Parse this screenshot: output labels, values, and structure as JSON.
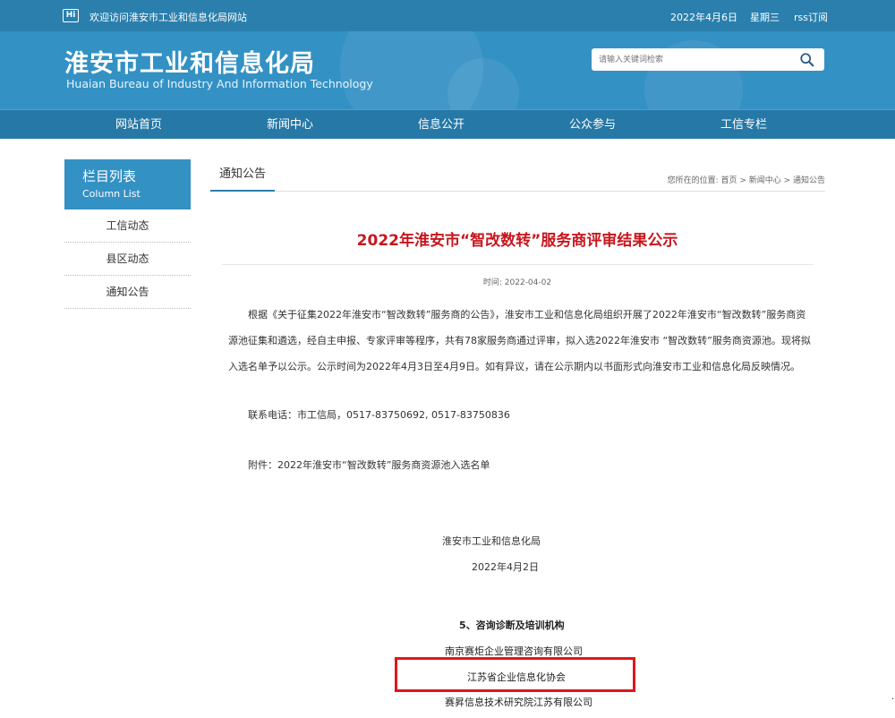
{
  "topbar": {
    "logo": "Hi",
    "welcome": "欢迎访问淮安市工业和信息化局网站",
    "date": "2022年4月6日",
    "weekday": "星期三",
    "rss": "rss订阅"
  },
  "header": {
    "title": "淮安市工业和信息化局",
    "subtitle": "Huaian Bureau of Industry And Information Technology",
    "search_placeholder": "请输入关键词检索"
  },
  "nav": {
    "items": [
      "网站首页",
      "新闻中心",
      "信息公开",
      "公众参与",
      "工信专栏"
    ]
  },
  "sidebar": {
    "title_cn": "栏目列表",
    "title_en": "Column List",
    "items": [
      "工信动态",
      "县区动态",
      "通知公告"
    ]
  },
  "content": {
    "tab": "通知公告",
    "breadcrumb": "您所在的位置:  首页 > 新闻中心 > 通知公告",
    "title": "2022年淮安市“智改数转”服务商评审结果公示",
    "time": "时间: 2022-04-02",
    "paragraph": "根据《关于征集2022年淮安市“智改数转”服务商的公告》，淮安市工业和信息化局组织开展了2022年淮安市“智改数转”服务商资源池征集和遴选，经自主申报、专家评审等程序，共有78家服务商通过评审，拟入选2022年淮安市 “智改数转”服务商资源池。现将拟入选名单予以公示。公示时间为2022年4月3日至4月9日。如有异议，请在公示期内以书面形式向淮安市工业和信息化局反映情况。",
    "contact": "联系电话：市工信局，0517-83750692, 0517-83750836",
    "attachment": "附件：2022年淮安市“智改数转”服务商资源池入选名单",
    "signer": "淮安市工业和信息化局",
    "sign_date": "2022年4月2日"
  },
  "list": {
    "section_title": "5、咨询诊断及培训机构",
    "rows": [
      "南京赛炬企业管理咨询有限公司",
      "江苏省企业信息化协会",
      "赛昇信息技术研究院江苏有限公司"
    ]
  },
  "colors": {
    "topbar": "#2a7fad",
    "header": "#3391c4",
    "nav": "#2678a6",
    "title_red": "#c8161d",
    "highlight": "#e0161d"
  }
}
